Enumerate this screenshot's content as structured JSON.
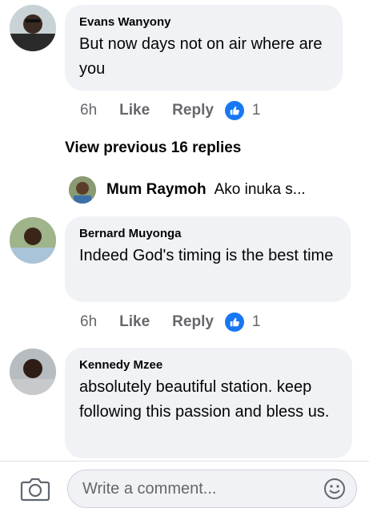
{
  "comments": [
    {
      "author": "Evans Wanyony",
      "text": "But now days not on air where are you",
      "time": "6h",
      "like_label": "Like",
      "reply_label": "Reply",
      "reaction_count": "1"
    },
    {
      "author": "Bernard Muyonga",
      "text": "Indeed God's timing is the best time",
      "time": "6h",
      "like_label": "Like",
      "reply_label": "Reply",
      "reaction_count": "1"
    },
    {
      "author": "Kennedy Mzee",
      "text": "absolutely beautiful station. keep following this passion and bless us."
    }
  ],
  "view_previous": "View previous 16 replies",
  "reply_preview": {
    "name": "Mum Raymoh",
    "text": "Ako inuka s..."
  },
  "composer": {
    "placeholder": "Write a comment..."
  },
  "icons": {
    "camera": "camera-icon",
    "emoji": "smiley-icon",
    "like_reaction": "thumbs-up-icon"
  },
  "colors": {
    "bubble": "#f0f2f5",
    "like_badge": "#1877f2",
    "meta_text": "#65676b"
  }
}
